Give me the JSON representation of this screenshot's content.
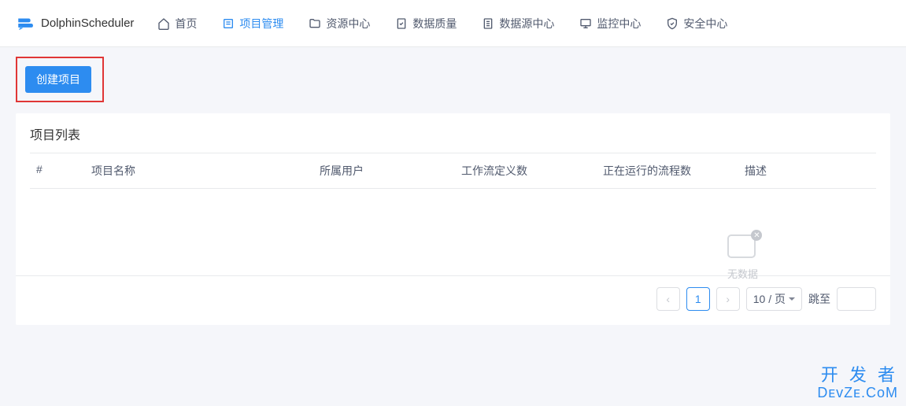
{
  "brand": {
    "name": "DolphinScheduler"
  },
  "nav": {
    "home": "首页",
    "project": "项目管理",
    "resource": "资源中心",
    "quality": "数据质量",
    "datasource": "数据源中心",
    "monitor": "监控中心",
    "security": "安全中心"
  },
  "toolbar": {
    "create_project": "创建项目"
  },
  "list": {
    "title": "项目列表",
    "columns": {
      "index": "#",
      "name": "项目名称",
      "user": "所属用户",
      "workflow_count": "工作流定义数",
      "running_count": "正在运行的流程数",
      "description": "描述"
    },
    "rows": [],
    "empty": "无数据"
  },
  "pagination": {
    "current": "1",
    "size_label": "10 / 页",
    "jump_label": "跳至"
  },
  "watermark": {
    "line1": "开 发 者",
    "line2": "DᴇᴠZᴇ.CᴏM"
  }
}
